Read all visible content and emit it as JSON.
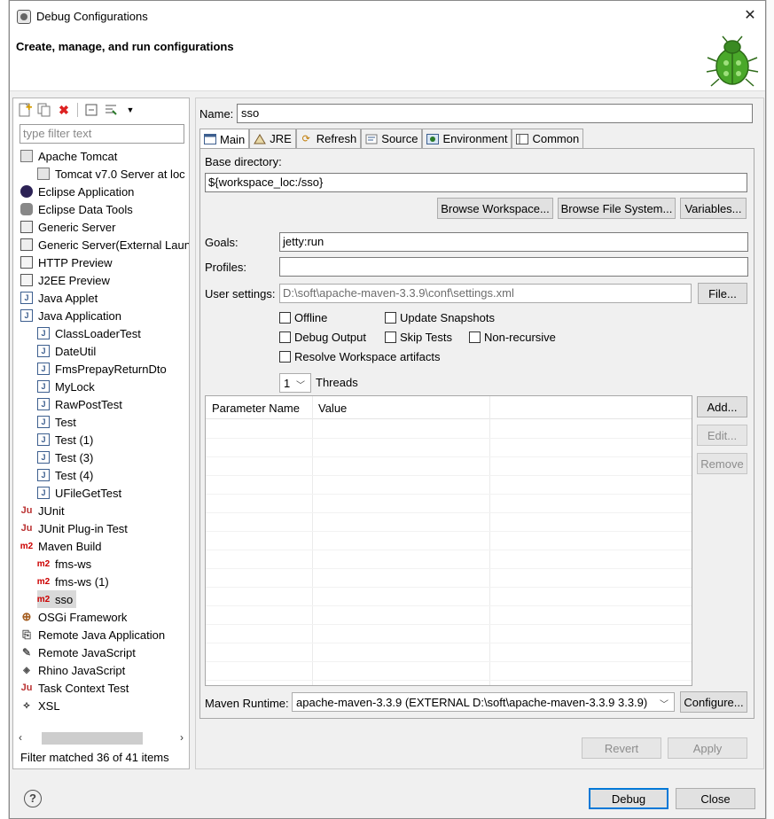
{
  "window": {
    "title": "Debug Configurations",
    "close_glyph": "✕"
  },
  "header": {
    "title": "Create, manage, and run configurations"
  },
  "left": {
    "filter_placeholder": "type filter text",
    "tree": [
      {
        "label": "Apache Tomcat",
        "icon": "tomcat-icon",
        "level": 0
      },
      {
        "label": "Tomcat v7.0 Server at loc",
        "icon": "tomcat-icon",
        "level": 1
      },
      {
        "label": "Eclipse Application",
        "icon": "eclipse-icon",
        "level": 0
      },
      {
        "label": "Eclipse Data Tools",
        "icon": "database-icon",
        "level": 0
      },
      {
        "label": "Generic Server",
        "icon": "server-icon",
        "level": 0
      },
      {
        "label": "Generic Server(External Laun",
        "icon": "server-icon",
        "level": 0
      },
      {
        "label": "HTTP Preview",
        "icon": "http-icon",
        "level": 0
      },
      {
        "label": "J2EE Preview",
        "icon": "http-icon",
        "level": 0
      },
      {
        "label": "Java Applet",
        "icon": "java-icon",
        "level": 0
      },
      {
        "label": "Java Application",
        "icon": "java-icon",
        "level": 0
      },
      {
        "label": "ClassLoaderTest",
        "icon": "java-icon",
        "level": 1
      },
      {
        "label": "DateUtil",
        "icon": "java-icon",
        "level": 1
      },
      {
        "label": "FmsPrepayReturnDto",
        "icon": "java-icon",
        "level": 1
      },
      {
        "label": "MyLock",
        "icon": "java-icon",
        "level": 1
      },
      {
        "label": "RawPostTest",
        "icon": "java-icon",
        "level": 1
      },
      {
        "label": "Test",
        "icon": "java-icon",
        "level": 1
      },
      {
        "label": "Test (1)",
        "icon": "java-icon",
        "level": 1
      },
      {
        "label": "Test (3)",
        "icon": "java-icon",
        "level": 1
      },
      {
        "label": "Test (4)",
        "icon": "java-icon",
        "level": 1
      },
      {
        "label": "UFileGetTest",
        "icon": "java-icon",
        "level": 1
      },
      {
        "label": "JUnit",
        "icon": "junit-icon",
        "level": 0
      },
      {
        "label": "JUnit Plug-in Test",
        "icon": "junit-icon",
        "level": 0
      },
      {
        "label": "Maven Build",
        "icon": "maven-icon",
        "level": 0
      },
      {
        "label": "fms-ws",
        "icon": "maven-icon",
        "level": 1
      },
      {
        "label": "fms-ws (1)",
        "icon": "maven-icon",
        "level": 1
      },
      {
        "label": "sso",
        "icon": "maven-icon",
        "level": 1,
        "selected": true
      },
      {
        "label": "OSGi Framework",
        "icon": "osgi-icon",
        "level": 0
      },
      {
        "label": "Remote Java Application",
        "icon": "remote-java-icon",
        "level": 0
      },
      {
        "label": "Remote JavaScript",
        "icon": "remote-js-icon",
        "level": 0
      },
      {
        "label": "Rhino JavaScript",
        "icon": "rhino-icon",
        "level": 0
      },
      {
        "label": "Task Context Test",
        "icon": "junit-icon",
        "level": 0
      },
      {
        "label": "XSL",
        "icon": "xsl-icon",
        "level": 0
      }
    ],
    "status": "Filter matched 36 of 41 items"
  },
  "right": {
    "name_label": "Name:",
    "name_value": "sso",
    "tabs": [
      {
        "label": "Main",
        "icon": "main-tab-icon",
        "active": true
      },
      {
        "label": "JRE",
        "icon": "jre-tab-icon"
      },
      {
        "label": "Refresh",
        "icon": "refresh-tab-icon"
      },
      {
        "label": "Source",
        "icon": "source-tab-icon"
      },
      {
        "label": "Environment",
        "icon": "environment-tab-icon"
      },
      {
        "label": "Common",
        "icon": "common-tab-icon"
      }
    ],
    "main": {
      "base_dir_label": "Base directory:",
      "base_dir_value": "${workspace_loc:/sso}",
      "browse_workspace": "Browse Workspace...",
      "browse_fs": "Browse File System...",
      "variables": "Variables...",
      "goals_label": "Goals:",
      "goals_value": "jetty:run",
      "profiles_label": "Profiles:",
      "profiles_value": "",
      "user_settings_label": "User settings:",
      "user_settings_value": "D:\\soft\\apache-maven-3.3.9\\conf\\settings.xml",
      "file_button": "File...",
      "cb_offline": "Offline",
      "cb_update_snapshots": "Update Snapshots",
      "cb_debug_output": "Debug Output",
      "cb_skip_tests": "Skip Tests",
      "cb_non_recursive": "Non-recursive",
      "cb_resolve_ws": "Resolve Workspace artifacts",
      "threads_value": "1",
      "threads_label": "Threads",
      "col_param_name": "Parameter Name",
      "col_value": "Value",
      "add": "Add...",
      "edit": "Edit...",
      "remove": "Remove",
      "runtime_label": "Maven Runtime:",
      "runtime_value": "apache-maven-3.3.9 (EXTERNAL D:\\soft\\apache-maven-3.3.9 3.3.9)",
      "configure": "Configure..."
    },
    "revert": "Revert",
    "apply": "Apply"
  },
  "footer": {
    "help": "?",
    "debug": "Debug",
    "close": "Close"
  }
}
